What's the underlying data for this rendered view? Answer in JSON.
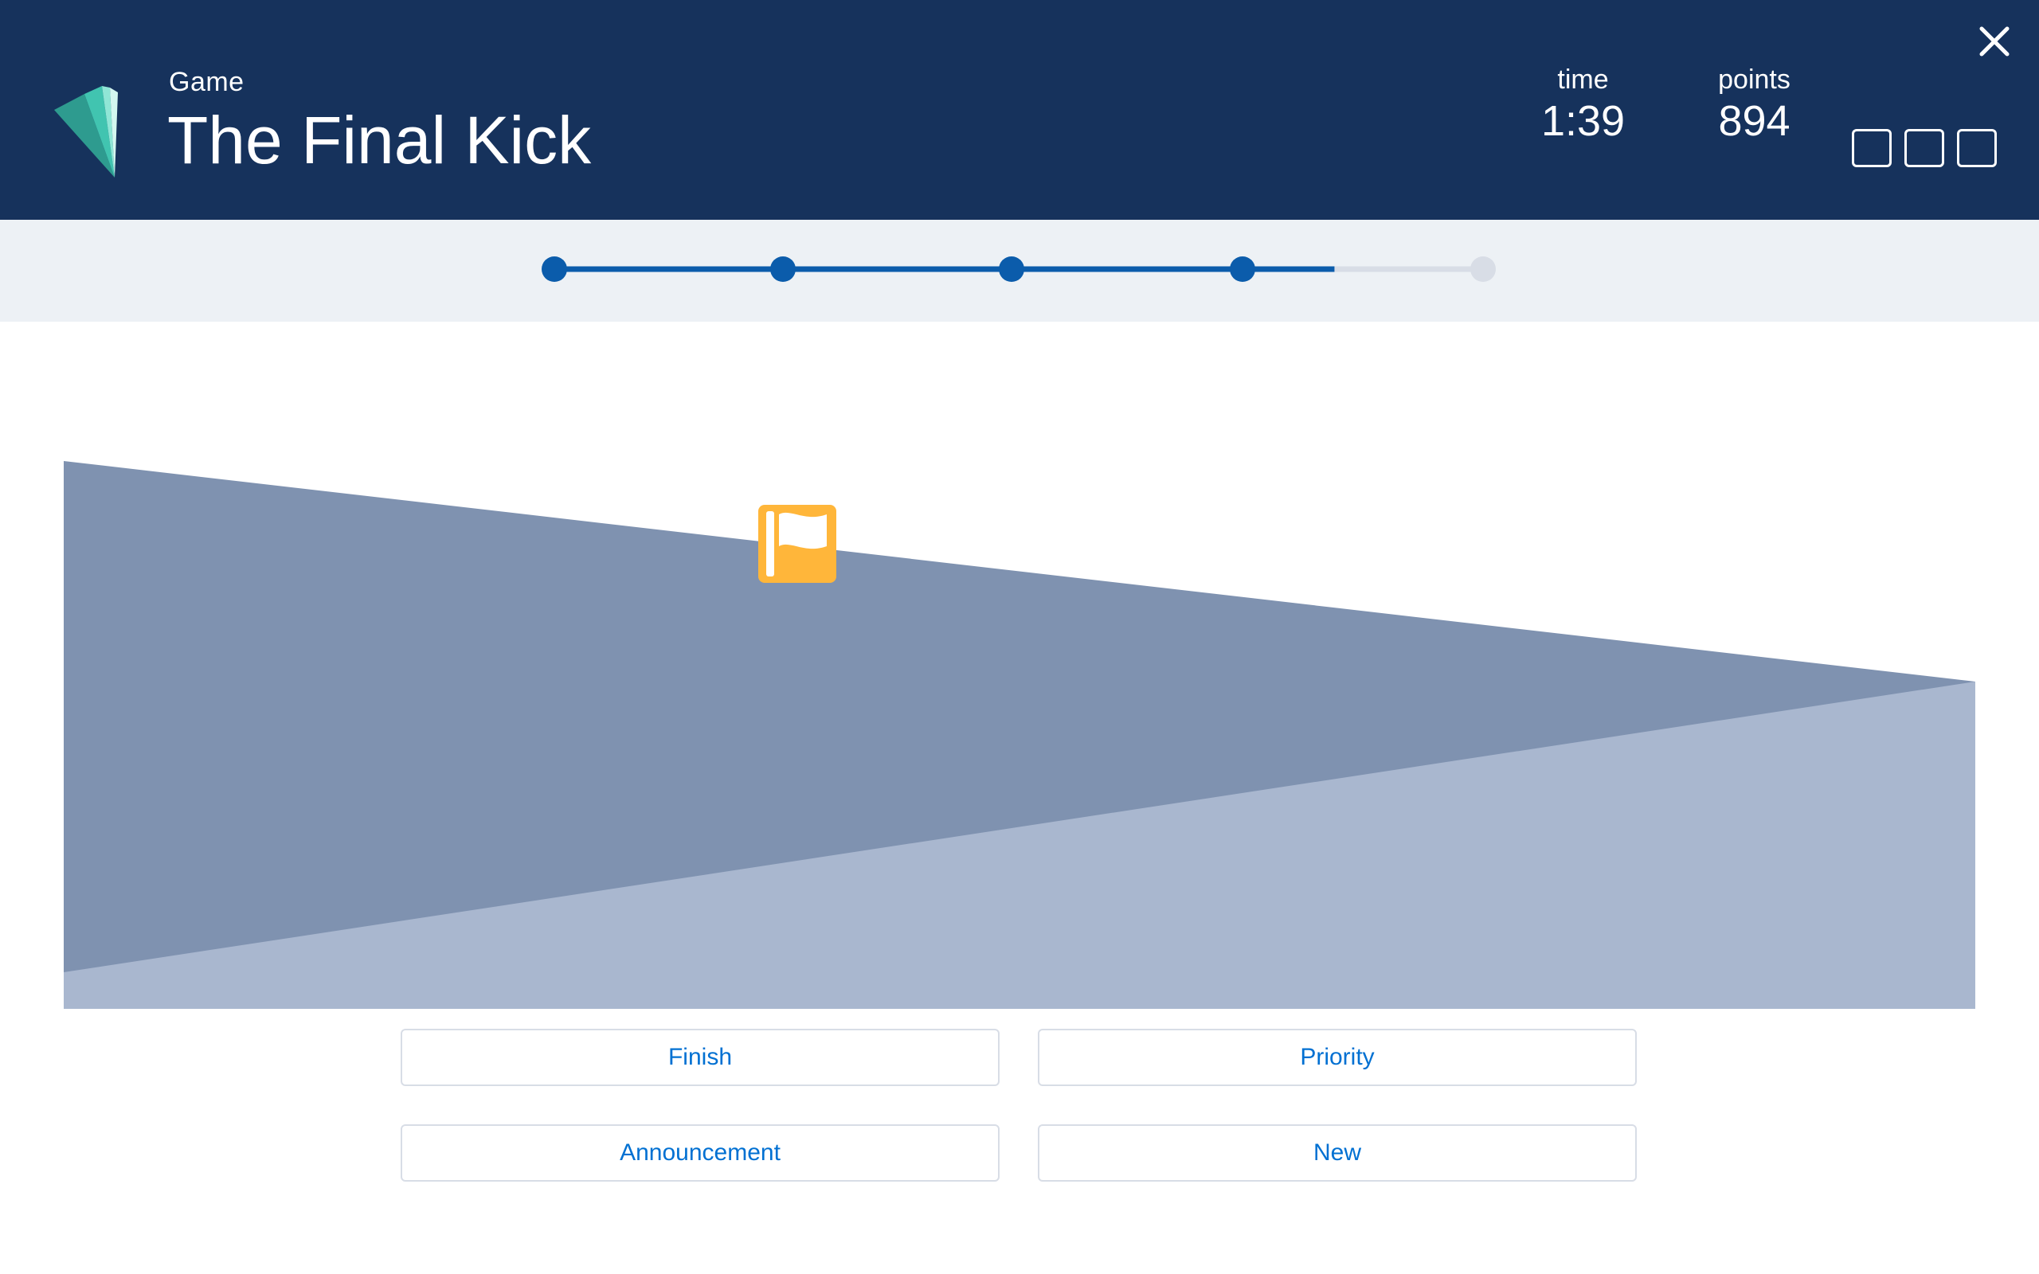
{
  "header": {
    "eyebrow": "Game",
    "title": "The Final Kick",
    "time_label": "time",
    "time_value": "1:39",
    "points_label": "points",
    "points_value": "894",
    "close_icon": "close-icon",
    "logo_icon": "trailhead-logo-icon",
    "result_slots": 3
  },
  "progress": {
    "total_steps": 5,
    "completed_steps": 4,
    "fill_fraction": 0.84,
    "active_color": "#0b5cab",
    "inactive_color": "#d8dde6"
  },
  "field": {
    "upper_color": "#7f92b0",
    "lower_color": "#a9b7cf",
    "marker_icon": "flag-icon",
    "marker_color": "#ffb63a"
  },
  "answers": [
    "Finish",
    "Priority",
    "Announcement",
    "New"
  ],
  "colors": {
    "header_bg": "#16325c",
    "band_bg": "#edf1f5",
    "button_text": "#0070d2"
  }
}
